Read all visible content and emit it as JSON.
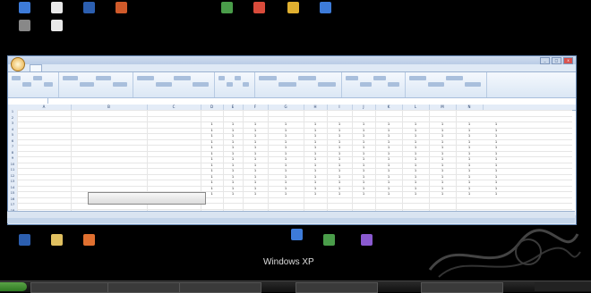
{
  "desktop": {
    "top_icons": [
      {
        "label": "",
        "color": "#3d7bd9"
      },
      {
        "label": "",
        "color": "#e8e8e8"
      },
      {
        "label": "",
        "color": "#2c5fb0"
      },
      {
        "label": "",
        "color": "#d05a2a"
      },
      {
        "label": "",
        "color": "#4a9d4a"
      },
      {
        "label": "",
        "color": "#d94b3b"
      },
      {
        "label": "",
        "color": "#e0b030"
      },
      {
        "label": "",
        "color": "#3d7bd9"
      },
      {
        "label": "",
        "color": "#888888"
      },
      {
        "label": "",
        "color": "#e8e8e8"
      }
    ],
    "bottom_icons": [
      {
        "label": "",
        "color": "#2c5fb0"
      },
      {
        "label": "",
        "color": "#e0c060"
      },
      {
        "label": "",
        "color": "#e07030"
      },
      {
        "label": "",
        "color": "#3d7bd9"
      },
      {
        "label": "",
        "color": "#4a9d4a"
      },
      {
        "label": "",
        "color": "#8a5ad0"
      }
    ],
    "wallpaper_text": "Windows XP"
  },
  "excel": {
    "title": "",
    "tabs": [
      "",
      "",
      "",
      "",
      "",
      "",
      "",
      ""
    ],
    "active_tab_index": 0,
    "ribbon_groups": [
      "",
      "",
      "",
      "",
      "",
      "",
      ""
    ],
    "name_box": "",
    "formula": "",
    "column_headers": [
      "A",
      "B",
      "C",
      "D",
      "E",
      "F",
      "G",
      "H",
      "I",
      "J",
      "K",
      "L",
      "M",
      "N"
    ],
    "row_numbers": [
      "1",
      "2",
      "3",
      "4",
      "5",
      "6",
      "7",
      "8",
      "9",
      "10",
      "11",
      "12",
      "13",
      "14",
      "15",
      "16",
      "17",
      "18"
    ],
    "header_cells": [
      "",
      "",
      "",
      ""
    ],
    "sub_headers": [
      "",
      "",
      "",
      "",
      "",
      "",
      "",
      "",
      "",
      "",
      "",
      ""
    ],
    "rows": [
      {
        "name": "",
        "val": "",
        "nums": [
          "1",
          "1",
          "1",
          "1",
          "1",
          "1",
          "1",
          "1",
          "1",
          "1",
          "1",
          "1"
        ]
      },
      {
        "name": "",
        "val": "",
        "nums": [
          "1",
          "1",
          "1",
          "1",
          "1",
          "1",
          "1",
          "1",
          "1",
          "1",
          "1",
          "1"
        ]
      },
      {
        "name": "",
        "val": "",
        "nums": [
          "1",
          "1",
          "1",
          "1",
          "1",
          "1",
          "1",
          "1",
          "1",
          "1",
          "1",
          "1"
        ]
      },
      {
        "name": "",
        "val": "",
        "nums": [
          "1",
          "1",
          "1",
          "1",
          "1",
          "1",
          "1",
          "1",
          "1",
          "1",
          "1",
          "1"
        ]
      },
      {
        "name": "",
        "val": "",
        "nums": [
          "1",
          "1",
          "1",
          "1",
          "1",
          "1",
          "1",
          "1",
          "1",
          "1",
          "1",
          "1"
        ]
      },
      {
        "name": "",
        "val": "",
        "nums": [
          "1",
          "1",
          "1",
          "1",
          "1",
          "1",
          "1",
          "1",
          "1",
          "1",
          "1",
          "1"
        ]
      },
      {
        "name": "",
        "val": "",
        "nums": [
          "1",
          "1",
          "1",
          "1",
          "1",
          "1",
          "1",
          "1",
          "1",
          "1",
          "1",
          "1"
        ]
      },
      {
        "name": "",
        "val": "",
        "nums": [
          "1",
          "1",
          "1",
          "1",
          "1",
          "1",
          "1",
          "1",
          "1",
          "1",
          "1",
          "1"
        ]
      },
      {
        "name": "",
        "val": "",
        "nums": [
          "1",
          "1",
          "1",
          "1",
          "1",
          "1",
          "1",
          "1",
          "1",
          "1",
          "1",
          "1"
        ]
      },
      {
        "name": "",
        "val": "",
        "nums": [
          "1",
          "1",
          "1",
          "1",
          "1",
          "1",
          "1",
          "1",
          "1",
          "1",
          "1",
          "1"
        ]
      },
      {
        "name": "",
        "val": "",
        "nums": [
          "1",
          "1",
          "1",
          "1",
          "1",
          "1",
          "1",
          "1",
          "1",
          "1",
          "1",
          "1"
        ]
      },
      {
        "name": "",
        "val": "",
        "nums": [
          "1",
          "1",
          "1",
          "1",
          "1",
          "1",
          "1",
          "1",
          "1",
          "1",
          "1",
          "1"
        ]
      },
      {
        "name": "",
        "val": "",
        "nums": [
          "1",
          "1",
          "1",
          "1",
          "1",
          "1",
          "1",
          "1",
          "1",
          "1",
          "1",
          "1"
        ]
      }
    ],
    "button_label": "",
    "sheet_tabs": [
      "",
      "",
      ""
    ],
    "status": ""
  },
  "taskbar": {
    "start_label": "",
    "tasks": [
      "",
      "",
      "",
      "",
      ""
    ],
    "clock": ""
  }
}
